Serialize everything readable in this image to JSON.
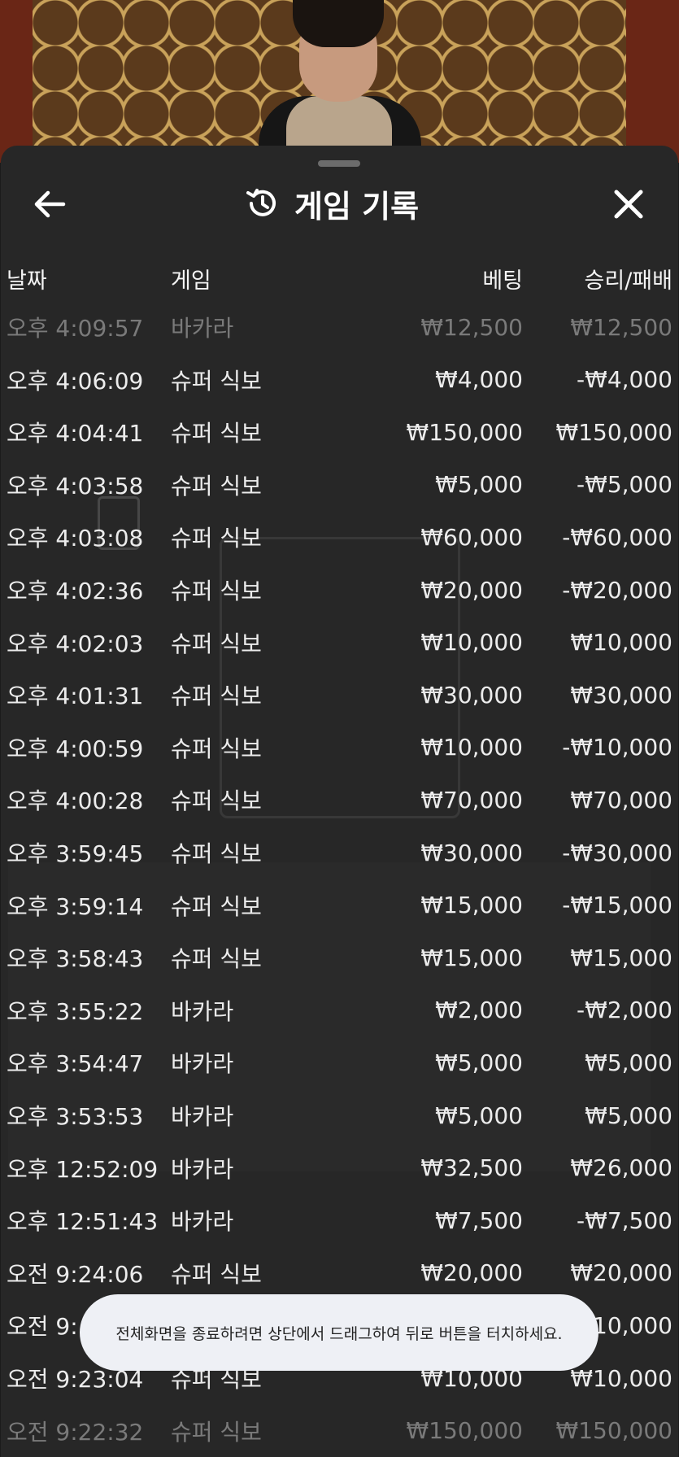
{
  "header": {
    "title": "게임 기록"
  },
  "table": {
    "headers": {
      "date": "날짜",
      "game": "게임",
      "bet": "베팅",
      "result": "승리/패배"
    },
    "rows": [
      {
        "date": "오후 4:09:57",
        "game": "바카라",
        "bet": "₩12,500",
        "result": "₩12,500"
      },
      {
        "date": "오후 4:06:09",
        "game": "슈퍼 식보",
        "bet": "₩4,000",
        "result": "-₩4,000"
      },
      {
        "date": "오후 4:04:41",
        "game": "슈퍼 식보",
        "bet": "₩150,000",
        "result": "₩150,000"
      },
      {
        "date": "오후 4:03:58",
        "game": "슈퍼 식보",
        "bet": "₩5,000",
        "result": "-₩5,000"
      },
      {
        "date": "오후 4:03:08",
        "game": "슈퍼 식보",
        "bet": "₩60,000",
        "result": "-₩60,000"
      },
      {
        "date": "오후 4:02:36",
        "game": "슈퍼 식보",
        "bet": "₩20,000",
        "result": "-₩20,000"
      },
      {
        "date": "오후 4:02:03",
        "game": "슈퍼 식보",
        "bet": "₩10,000",
        "result": "₩10,000"
      },
      {
        "date": "오후 4:01:31",
        "game": "슈퍼 식보",
        "bet": "₩30,000",
        "result": "₩30,000"
      },
      {
        "date": "오후 4:00:59",
        "game": "슈퍼 식보",
        "bet": "₩10,000",
        "result": "-₩10,000"
      },
      {
        "date": "오후 4:00:28",
        "game": "슈퍼 식보",
        "bet": "₩70,000",
        "result": "₩70,000"
      },
      {
        "date": "오후 3:59:45",
        "game": "슈퍼 식보",
        "bet": "₩30,000",
        "result": "-₩30,000"
      },
      {
        "date": "오후 3:59:14",
        "game": "슈퍼 식보",
        "bet": "₩15,000",
        "result": "-₩15,000"
      },
      {
        "date": "오후 3:58:43",
        "game": "슈퍼 식보",
        "bet": "₩15,000",
        "result": "₩15,000"
      },
      {
        "date": "오후 3:55:22",
        "game": "바카라",
        "bet": "₩2,000",
        "result": "-₩2,000"
      },
      {
        "date": "오후 3:54:47",
        "game": "바카라",
        "bet": "₩5,000",
        "result": "₩5,000"
      },
      {
        "date": "오후 3:53:53",
        "game": "바카라",
        "bet": "₩5,000",
        "result": "₩5,000"
      },
      {
        "date": "오후 12:52:09",
        "game": "바카라",
        "bet": "₩32,500",
        "result": "₩26,000"
      },
      {
        "date": "오후 12:51:43",
        "game": "바카라",
        "bet": "₩7,500",
        "result": "-₩7,500"
      },
      {
        "date": "오전 9:24:06",
        "game": "슈퍼 식보",
        "bet": "₩20,000",
        "result": "₩20,000"
      },
      {
        "date": "오전 9:",
        "game": "",
        "bet": "",
        "result": "10,000"
      },
      {
        "date": "오전 9:23:04",
        "game": "슈퍼 식보",
        "bet": "₩10,000",
        "result": "₩10,000"
      },
      {
        "date": "오전 9:22:32",
        "game": "슈퍼 식보",
        "bet": "₩150,000",
        "result": "₩150,000"
      }
    ]
  },
  "toast": {
    "message": "전체화면을 종료하려면 상단에서 드래그하여 뒤로 버튼을 터치하세요."
  },
  "icons": {
    "back": "arrow-left-icon",
    "history": "history-icon",
    "close": "close-icon"
  }
}
